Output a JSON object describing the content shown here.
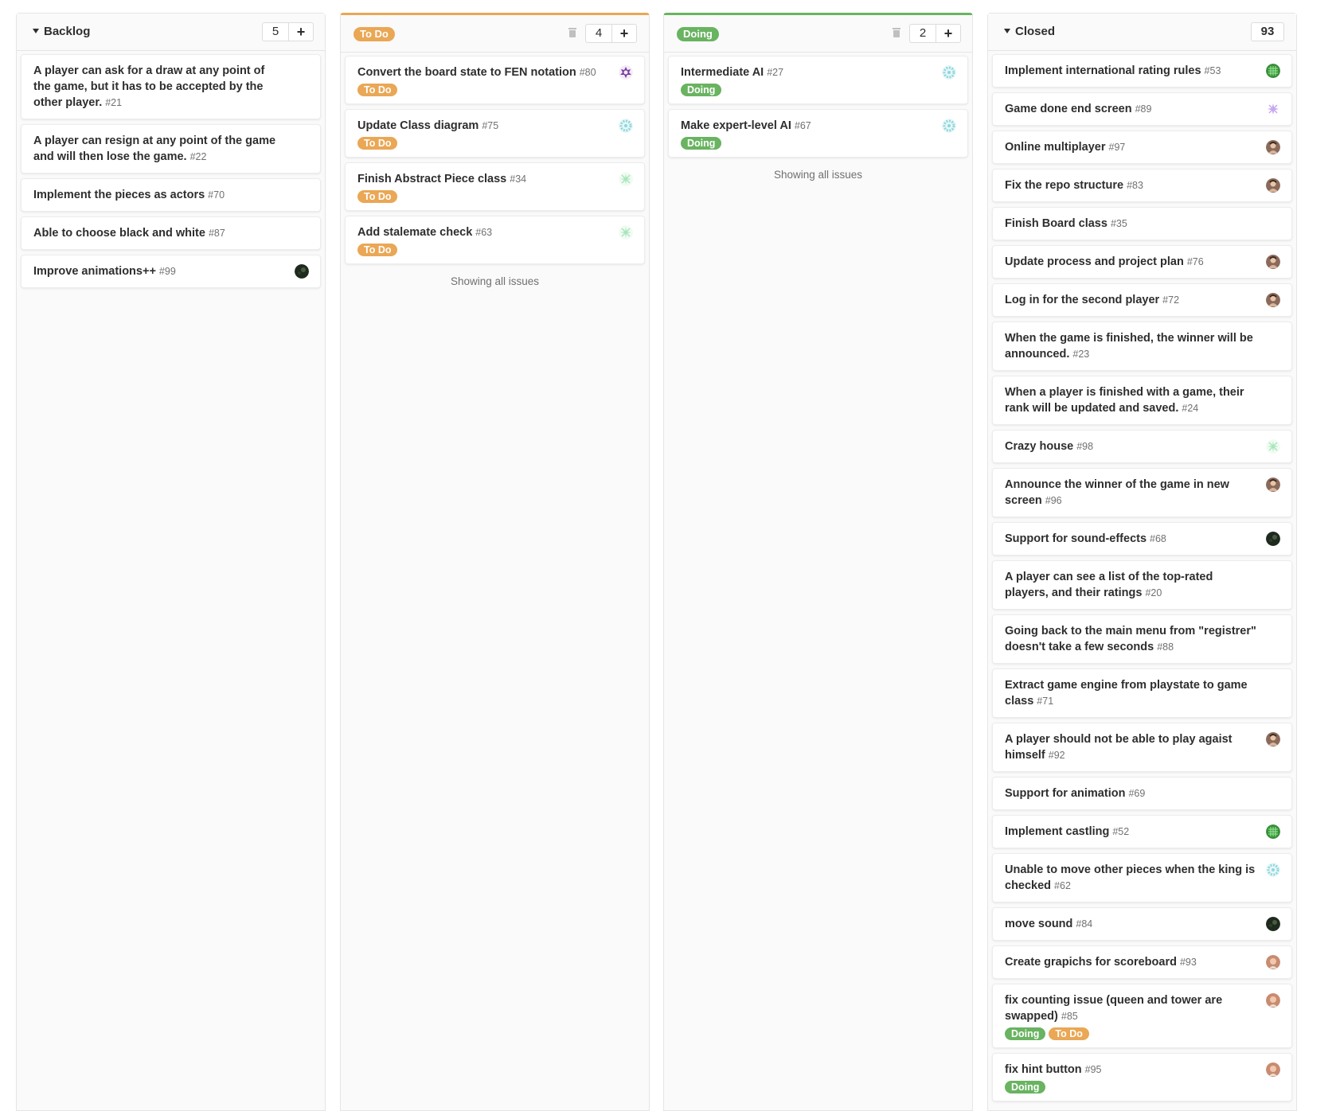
{
  "colors": {
    "todo": "#eaa755",
    "doing": "#69b361"
  },
  "backlog": {
    "title": "Backlog",
    "count": "5",
    "add_label": "+",
    "cards": [
      {
        "title": "A player can ask for a draw at any point of the game, but it has to be accepted by the other player.",
        "number": "#21",
        "labels": [],
        "avatar": ""
      },
      {
        "title": "A player can resign at any point of the game and will then lose the game.",
        "number": "#22",
        "labels": [],
        "avatar": ""
      },
      {
        "title": "Implement the pieces as actors",
        "number": "#70",
        "labels": [],
        "avatar": ""
      },
      {
        "title": "Able to choose black and white",
        "number": "#87",
        "labels": [],
        "avatar": ""
      },
      {
        "title": "Improve animations++",
        "number": "#99",
        "labels": [],
        "avatar": "dark-avatar"
      }
    ]
  },
  "todo": {
    "label": "To Do",
    "count": "4",
    "add_label": "+",
    "footer": "Showing all issues",
    "cards": [
      {
        "title": "Convert the board state to FEN notation",
        "number": "#80",
        "labels": [
          "To Do"
        ],
        "avatar": "purple-identicon"
      },
      {
        "title": "Update Class diagram",
        "number": "#75",
        "labels": [
          "To Do"
        ],
        "avatar": "teal-identicon"
      },
      {
        "title": "Finish Abstract Piece class",
        "number": "#34",
        "labels": [
          "To Do"
        ],
        "avatar": "mint-identicon"
      },
      {
        "title": "Add stalemate check",
        "number": "#63",
        "labels": [
          "To Do"
        ],
        "avatar": "mint-identicon"
      }
    ]
  },
  "doing": {
    "label": "Doing",
    "count": "2",
    "add_label": "+",
    "footer": "Showing all issues",
    "cards": [
      {
        "title": "Intermediate AI",
        "number": "#27",
        "labels": [
          "Doing"
        ],
        "avatar": "teal-identicon"
      },
      {
        "title": "Make expert-level AI",
        "number": "#67",
        "labels": [
          "Doing"
        ],
        "avatar": "teal-identicon"
      }
    ]
  },
  "closed": {
    "title": "Closed",
    "count": "93",
    "cards": [
      {
        "title": "Implement international rating rules",
        "number": "#53",
        "labels": [],
        "avatar": "green-identicon"
      },
      {
        "title": "Game done end screen",
        "number": "#89",
        "labels": [],
        "avatar": "lavender-identicon"
      },
      {
        "title": "Online multiplayer",
        "number": "#97",
        "labels": [],
        "avatar": "photo-avatar"
      },
      {
        "title": "Fix the repo structure",
        "number": "#83",
        "labels": [],
        "avatar": "photo-avatar"
      },
      {
        "title": "Finish Board class",
        "number": "#35",
        "labels": [],
        "avatar": ""
      },
      {
        "title": "Update process and project plan",
        "number": "#76",
        "labels": [],
        "avatar": "photo-avatar"
      },
      {
        "title": "Log in for the second player",
        "number": "#72",
        "labels": [],
        "avatar": "photo-avatar"
      },
      {
        "title": "When the game is finished, the winner will be announced.",
        "number": "#23",
        "labels": [],
        "avatar": ""
      },
      {
        "title": "When a player is finished with a game, their rank will be updated and saved.",
        "number": "#24",
        "labels": [],
        "avatar": ""
      },
      {
        "title": "Crazy house",
        "number": "#98",
        "labels": [],
        "avatar": "mint-identicon"
      },
      {
        "title": "Announce the winner of the game in new screen",
        "number": "#96",
        "labels": [],
        "avatar": "photo-avatar"
      },
      {
        "title": "Support for sound-effects",
        "number": "#68",
        "labels": [],
        "avatar": "dark-avatar"
      },
      {
        "title": "A player can see a list of the top-rated players, and their ratings",
        "number": "#20",
        "labels": [],
        "avatar": ""
      },
      {
        "title": "Going back to the main menu from \"registrer\" doesn't take a few seconds",
        "number": "#88",
        "labels": [],
        "avatar": ""
      },
      {
        "title": "Extract game engine from playstate to game class",
        "number": "#71",
        "labels": [],
        "avatar": ""
      },
      {
        "title": "A player should not be able to play agaist himself",
        "number": "#92",
        "labels": [],
        "avatar": "photo-avatar"
      },
      {
        "title": "Support for animation",
        "number": "#69",
        "labels": [],
        "avatar": ""
      },
      {
        "title": "Implement castling",
        "number": "#52",
        "labels": [],
        "avatar": "green-identicon"
      },
      {
        "title": "Unable to move other pieces when the king is checked",
        "number": "#62",
        "labels": [],
        "avatar": "teal-identicon"
      },
      {
        "title": "move sound",
        "number": "#84",
        "labels": [],
        "avatar": "dark-avatar"
      },
      {
        "title": "Create grapichs for scoreboard",
        "number": "#93",
        "labels": [],
        "avatar": "face-avatar"
      },
      {
        "title": "fix counting issue (queen and tower are swapped)",
        "number": "#85",
        "labels": [
          "Doing",
          "To Do"
        ],
        "avatar": "face-avatar"
      },
      {
        "title": "fix hint button",
        "number": "#95",
        "labels": [
          "Doing"
        ],
        "avatar": "face-avatar"
      }
    ]
  }
}
